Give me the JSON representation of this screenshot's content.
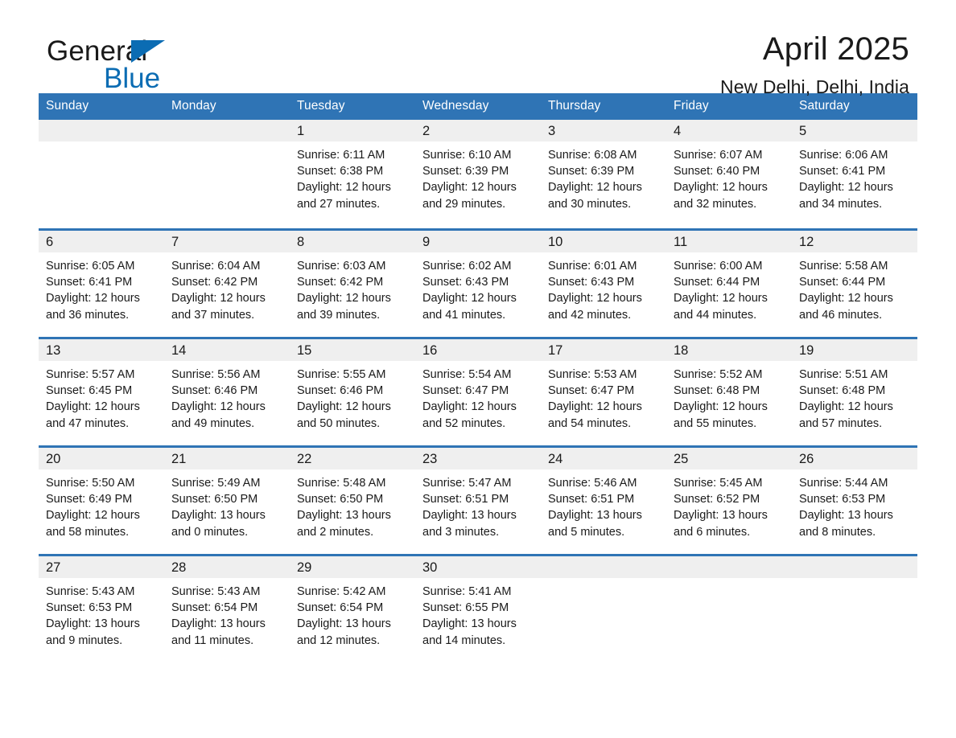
{
  "brand": {
    "name_line1": "General",
    "name_line2": "Blue",
    "logo_icon": "triangle-icon",
    "black": "#1a1a1a",
    "blue": "#0b6cb3"
  },
  "header": {
    "title": "April 2025",
    "subtitle": "New Delhi, Delhi, India"
  },
  "theme": {
    "header_blue": "#2f74b5",
    "row_divider_blue": "#2f74b5",
    "daynum_band": "#efefef",
    "text": "#1a1a1a"
  },
  "weekdays": [
    "Sunday",
    "Monday",
    "Tuesday",
    "Wednesday",
    "Thursday",
    "Friday",
    "Saturday"
  ],
  "weeks": [
    [
      {
        "day": "",
        "sunrise": "",
        "sunset": "",
        "daylight_line1": "",
        "daylight_line2": ""
      },
      {
        "day": "",
        "sunrise": "",
        "sunset": "",
        "daylight_line1": "",
        "daylight_line2": ""
      },
      {
        "day": "1",
        "sunrise": "Sunrise: 6:11 AM",
        "sunset": "Sunset: 6:38 PM",
        "daylight_line1": "Daylight: 12 hours",
        "daylight_line2": "and 27 minutes."
      },
      {
        "day": "2",
        "sunrise": "Sunrise: 6:10 AM",
        "sunset": "Sunset: 6:39 PM",
        "daylight_line1": "Daylight: 12 hours",
        "daylight_line2": "and 29 minutes."
      },
      {
        "day": "3",
        "sunrise": "Sunrise: 6:08 AM",
        "sunset": "Sunset: 6:39 PM",
        "daylight_line1": "Daylight: 12 hours",
        "daylight_line2": "and 30 minutes."
      },
      {
        "day": "4",
        "sunrise": "Sunrise: 6:07 AM",
        "sunset": "Sunset: 6:40 PM",
        "daylight_line1": "Daylight: 12 hours",
        "daylight_line2": "and 32 minutes."
      },
      {
        "day": "5",
        "sunrise": "Sunrise: 6:06 AM",
        "sunset": "Sunset: 6:41 PM",
        "daylight_line1": "Daylight: 12 hours",
        "daylight_line2": "and 34 minutes."
      }
    ],
    [
      {
        "day": "6",
        "sunrise": "Sunrise: 6:05 AM",
        "sunset": "Sunset: 6:41 PM",
        "daylight_line1": "Daylight: 12 hours",
        "daylight_line2": "and 36 minutes."
      },
      {
        "day": "7",
        "sunrise": "Sunrise: 6:04 AM",
        "sunset": "Sunset: 6:42 PM",
        "daylight_line1": "Daylight: 12 hours",
        "daylight_line2": "and 37 minutes."
      },
      {
        "day": "8",
        "sunrise": "Sunrise: 6:03 AM",
        "sunset": "Sunset: 6:42 PM",
        "daylight_line1": "Daylight: 12 hours",
        "daylight_line2": "and 39 minutes."
      },
      {
        "day": "9",
        "sunrise": "Sunrise: 6:02 AM",
        "sunset": "Sunset: 6:43 PM",
        "daylight_line1": "Daylight: 12 hours",
        "daylight_line2": "and 41 minutes."
      },
      {
        "day": "10",
        "sunrise": "Sunrise: 6:01 AM",
        "sunset": "Sunset: 6:43 PM",
        "daylight_line1": "Daylight: 12 hours",
        "daylight_line2": "and 42 minutes."
      },
      {
        "day": "11",
        "sunrise": "Sunrise: 6:00 AM",
        "sunset": "Sunset: 6:44 PM",
        "daylight_line1": "Daylight: 12 hours",
        "daylight_line2": "and 44 minutes."
      },
      {
        "day": "12",
        "sunrise": "Sunrise: 5:58 AM",
        "sunset": "Sunset: 6:44 PM",
        "daylight_line1": "Daylight: 12 hours",
        "daylight_line2": "and 46 minutes."
      }
    ],
    [
      {
        "day": "13",
        "sunrise": "Sunrise: 5:57 AM",
        "sunset": "Sunset: 6:45 PM",
        "daylight_line1": "Daylight: 12 hours",
        "daylight_line2": "and 47 minutes."
      },
      {
        "day": "14",
        "sunrise": "Sunrise: 5:56 AM",
        "sunset": "Sunset: 6:46 PM",
        "daylight_line1": "Daylight: 12 hours",
        "daylight_line2": "and 49 minutes."
      },
      {
        "day": "15",
        "sunrise": "Sunrise: 5:55 AM",
        "sunset": "Sunset: 6:46 PM",
        "daylight_line1": "Daylight: 12 hours",
        "daylight_line2": "and 50 minutes."
      },
      {
        "day": "16",
        "sunrise": "Sunrise: 5:54 AM",
        "sunset": "Sunset: 6:47 PM",
        "daylight_line1": "Daylight: 12 hours",
        "daylight_line2": "and 52 minutes."
      },
      {
        "day": "17",
        "sunrise": "Sunrise: 5:53 AM",
        "sunset": "Sunset: 6:47 PM",
        "daylight_line1": "Daylight: 12 hours",
        "daylight_line2": "and 54 minutes."
      },
      {
        "day": "18",
        "sunrise": "Sunrise: 5:52 AM",
        "sunset": "Sunset: 6:48 PM",
        "daylight_line1": "Daylight: 12 hours",
        "daylight_line2": "and 55 minutes."
      },
      {
        "day": "19",
        "sunrise": "Sunrise: 5:51 AM",
        "sunset": "Sunset: 6:48 PM",
        "daylight_line1": "Daylight: 12 hours",
        "daylight_line2": "and 57 minutes."
      }
    ],
    [
      {
        "day": "20",
        "sunrise": "Sunrise: 5:50 AM",
        "sunset": "Sunset: 6:49 PM",
        "daylight_line1": "Daylight: 12 hours",
        "daylight_line2": "and 58 minutes."
      },
      {
        "day": "21",
        "sunrise": "Sunrise: 5:49 AM",
        "sunset": "Sunset: 6:50 PM",
        "daylight_line1": "Daylight: 13 hours",
        "daylight_line2": "and 0 minutes."
      },
      {
        "day": "22",
        "sunrise": "Sunrise: 5:48 AM",
        "sunset": "Sunset: 6:50 PM",
        "daylight_line1": "Daylight: 13 hours",
        "daylight_line2": "and 2 minutes."
      },
      {
        "day": "23",
        "sunrise": "Sunrise: 5:47 AM",
        "sunset": "Sunset: 6:51 PM",
        "daylight_line1": "Daylight: 13 hours",
        "daylight_line2": "and 3 minutes."
      },
      {
        "day": "24",
        "sunrise": "Sunrise: 5:46 AM",
        "sunset": "Sunset: 6:51 PM",
        "daylight_line1": "Daylight: 13 hours",
        "daylight_line2": "and 5 minutes."
      },
      {
        "day": "25",
        "sunrise": "Sunrise: 5:45 AM",
        "sunset": "Sunset: 6:52 PM",
        "daylight_line1": "Daylight: 13 hours",
        "daylight_line2": "and 6 minutes."
      },
      {
        "day": "26",
        "sunrise": "Sunrise: 5:44 AM",
        "sunset": "Sunset: 6:53 PM",
        "daylight_line1": "Daylight: 13 hours",
        "daylight_line2": "and 8 minutes."
      }
    ],
    [
      {
        "day": "27",
        "sunrise": "Sunrise: 5:43 AM",
        "sunset": "Sunset: 6:53 PM",
        "daylight_line1": "Daylight: 13 hours",
        "daylight_line2": "and 9 minutes."
      },
      {
        "day": "28",
        "sunrise": "Sunrise: 5:43 AM",
        "sunset": "Sunset: 6:54 PM",
        "daylight_line1": "Daylight: 13 hours",
        "daylight_line2": "and 11 minutes."
      },
      {
        "day": "29",
        "sunrise": "Sunrise: 5:42 AM",
        "sunset": "Sunset: 6:54 PM",
        "daylight_line1": "Daylight: 13 hours",
        "daylight_line2": "and 12 minutes."
      },
      {
        "day": "30",
        "sunrise": "Sunrise: 5:41 AM",
        "sunset": "Sunset: 6:55 PM",
        "daylight_line1": "Daylight: 13 hours",
        "daylight_line2": "and 14 minutes."
      },
      {
        "day": "",
        "sunrise": "",
        "sunset": "",
        "daylight_line1": "",
        "daylight_line2": ""
      },
      {
        "day": "",
        "sunrise": "",
        "sunset": "",
        "daylight_line1": "",
        "daylight_line2": ""
      },
      {
        "day": "",
        "sunrise": "",
        "sunset": "",
        "daylight_line1": "",
        "daylight_line2": ""
      }
    ]
  ]
}
